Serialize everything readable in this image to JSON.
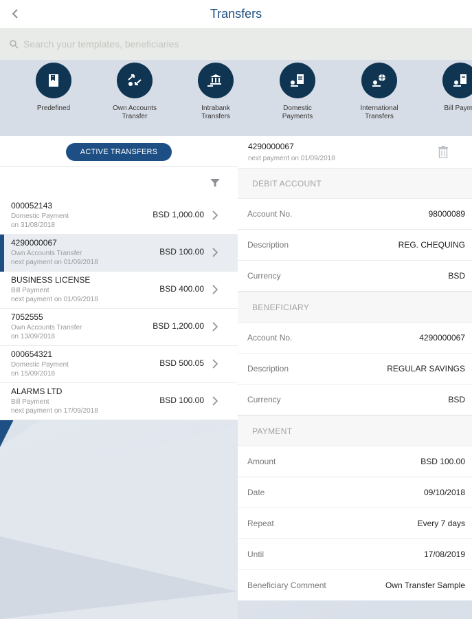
{
  "header": {
    "title": "Transfers"
  },
  "search": {
    "placeholder": "Search your templates, beneficiaries"
  },
  "categories": [
    {
      "label": "Predefined",
      "icon": "bookmark-icon"
    },
    {
      "label": "Own Accounts\nTransfer",
      "icon": "exchange-icon"
    },
    {
      "label": "Intrabank\nTransfers",
      "icon": "bank-transfer-icon"
    },
    {
      "label": "Domestic\nPayments",
      "icon": "document-transfer-icon"
    },
    {
      "label": "International\nTransfers",
      "icon": "globe-transfer-icon"
    },
    {
      "label": "Bill Payme",
      "icon": "bill-payment-icon"
    }
  ],
  "left": {
    "active_button": "ACTIVE TRANSFERS",
    "rows": [
      {
        "name": "000052143",
        "type": "Domestic Payment",
        "date": "on 31/08/2018",
        "amount": "BSD 1,000.00",
        "selected": false
      },
      {
        "name": "4290000067",
        "type": "Own Accounts Transfer",
        "date": "next payment on 01/09/2018",
        "amount": "BSD 100.00",
        "selected": true
      },
      {
        "name": "BUSINESS LICENSE",
        "type": "Bill Payment",
        "date": "next payment on 01/09/2018",
        "amount": "BSD 400.00",
        "selected": false
      },
      {
        "name": "7052555",
        "type": "Own Accounts Transfer",
        "date": "on 13/09/2018",
        "amount": "BSD 1,200.00",
        "selected": false
      },
      {
        "name": "000654321",
        "type": "Domestic Payment",
        "date": "on 15/09/2018",
        "amount": "BSD 500.05",
        "selected": false
      },
      {
        "name": "ALARMS LTD",
        "type": "Bill Payment",
        "date": "next payment on 17/09/2018",
        "amount": "BSD 100.00",
        "selected": false
      }
    ]
  },
  "detail": {
    "title": "4290000067",
    "subtitle": "next payment on 01/09/2018",
    "debit_header": "DEBIT ACCOUNT",
    "debit": [
      {
        "label": "Account No.",
        "value": "98000089"
      },
      {
        "label": "Description",
        "value": "REG. CHEQUING"
      },
      {
        "label": "Currency",
        "value": "BSD"
      }
    ],
    "beneficiary_header": "BENEFICIARY",
    "beneficiary": [
      {
        "label": "Account No.",
        "value": "4290000067"
      },
      {
        "label": "Description",
        "value": "REGULAR SAVINGS"
      },
      {
        "label": "Currency",
        "value": "BSD"
      }
    ],
    "payment_header": "PAYMENT",
    "payment": [
      {
        "label": "Amount",
        "value": "BSD 100.00"
      },
      {
        "label": "Date",
        "value": "09/10/2018"
      },
      {
        "label": "Repeat",
        "value": "Every 7 days"
      },
      {
        "label": "Until",
        "value": "17/08/2019"
      },
      {
        "label": "Beneficiary Comment",
        "value": "Own Transfer Sample"
      }
    ]
  },
  "colors": {
    "accent": "#1d4f84",
    "icon_bg": "#0f3552",
    "title": "#1b4e80"
  }
}
